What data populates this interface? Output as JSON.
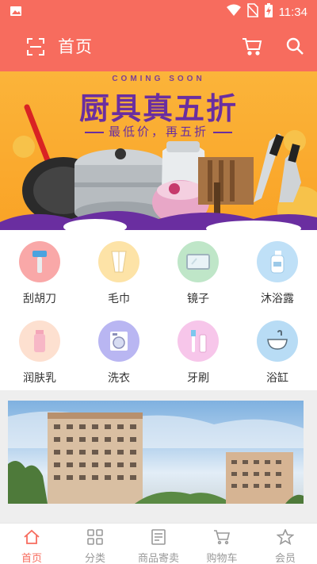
{
  "status_bar": {
    "time": "11:34"
  },
  "app_bar": {
    "title": "首页"
  },
  "banner": {
    "coming": "COMING SOON",
    "headline": "厨具真五折",
    "subtitle": "最低价，再五折"
  },
  "categories": [
    {
      "label": "刮胡刀",
      "color": "#f9a8a8",
      "icon": "razor-icon"
    },
    {
      "label": "毛巾",
      "color": "#fde3a7",
      "icon": "towel-icon"
    },
    {
      "label": "镜子",
      "color": "#bfe6c8",
      "icon": "mirror-icon"
    },
    {
      "label": "沐浴露",
      "color": "#bfe0f7",
      "icon": "shower-gel-icon"
    },
    {
      "label": "润肤乳",
      "color": "#fde0d0",
      "icon": "lotion-icon"
    },
    {
      "label": "洗衣",
      "color": "#b9b6f2",
      "icon": "washing-machine-icon"
    },
    {
      "label": "牙刷",
      "color": "#f7c6ea",
      "icon": "toothbrush-icon"
    },
    {
      "label": "浴缸",
      "color": "#b8dcf5",
      "icon": "basin-icon"
    }
  ],
  "bottom_nav": [
    {
      "label": "首页",
      "icon": "home-icon",
      "active": true
    },
    {
      "label": "分类",
      "icon": "grid-icon",
      "active": false
    },
    {
      "label": "商品寄卖",
      "icon": "consign-icon",
      "active": false
    },
    {
      "label": "购物车",
      "icon": "cart-icon",
      "active": false
    },
    {
      "label": "会员",
      "icon": "star-icon",
      "active": false
    }
  ],
  "colors": {
    "brand": "#f76c5e",
    "banner_purple": "#6a2ea0",
    "banner_orange": "#f9a326"
  }
}
